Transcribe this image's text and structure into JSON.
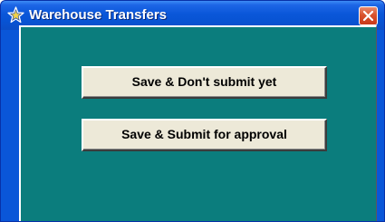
{
  "window": {
    "title": "Warehouse Transfers",
    "title_icon": "star-app-icon",
    "close_icon": "close-icon"
  },
  "actions": {
    "save_no_submit_label": "Save & Don't submit yet",
    "save_submit_label": "Save & Submit for approval"
  },
  "colors": {
    "titlebar": "#0a57d9",
    "panel": "#0b7d7d",
    "button_face": "#ede9d8",
    "close_button": "#d9532e"
  }
}
